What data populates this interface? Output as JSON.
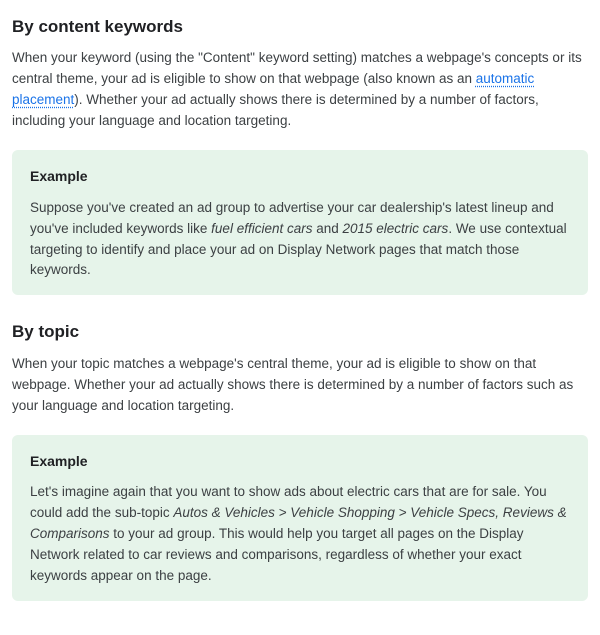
{
  "section1": {
    "heading": "By content keywords",
    "para_pre": "When your keyword (using the \"Content\" keyword setting) matches a webpage's concepts or its central theme, your ad is eligible to show on that webpage (also known as an ",
    "link_text": "automatic placement",
    "para_post": "). Whether your ad actually shows there is determined by a number of factors, including your language and location targeting.",
    "example_label": "Example",
    "example_pre": "Suppose you've created an ad group to advertise your car dealership's latest lineup and you've included keywords like ",
    "kw1": "fuel efficient cars",
    "example_mid": " and ",
    "kw2": "2015 electric cars",
    "example_post": ". We use contextual targeting to identify and place your ad on Display Network pages that match those keywords."
  },
  "section2": {
    "heading": "By topic",
    "para": "When your topic matches a webpage's central theme, your ad is eligible to show on that webpage. Whether your ad actually shows there is determined by a number of factors such as your language and location targeting.",
    "example_label": "Example",
    "example_pre": "Let's imagine again that you want to show ads about electric cars that are for sale. You could add the sub-topic ",
    "path": "Autos & Vehicles > Vehicle Shopping > Vehicle Specs, Reviews & Comparisons",
    "example_post": " to your ad group. This would help you target all pages on the Display Network related to car reviews and comparisons, regardless of whether your exact keywords appear on the page."
  }
}
